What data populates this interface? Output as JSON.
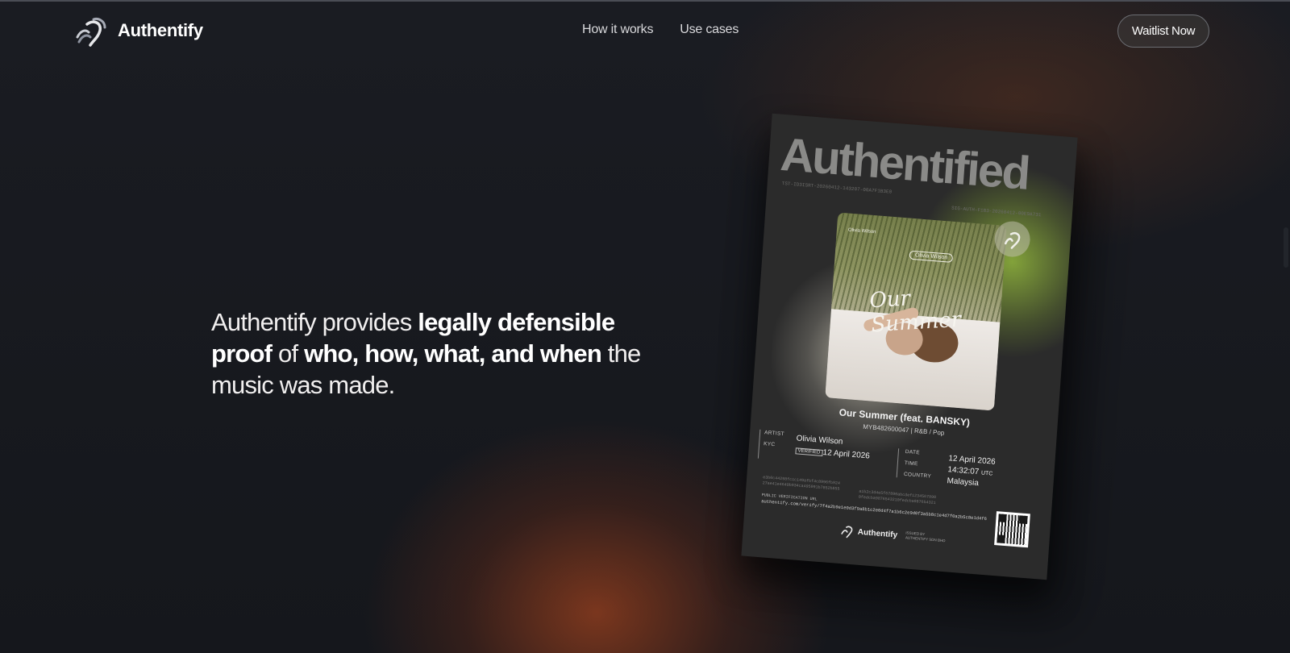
{
  "nav": {
    "brand": "Authentify",
    "links": [
      "How it works",
      "Use cases"
    ],
    "cta_label": "Waitlist Now"
  },
  "hero": {
    "p1": "Authentify provides ",
    "b1": "legally defensible proof",
    "p2": " of ",
    "b2": "who, how, what, and when",
    "p3": " the music was made."
  },
  "certificate": {
    "title": "Authentified",
    "code_left": "TST-ID3ISRT-20260412-143207-00A7F1B3E0",
    "code_right": "SIG-AUTH-F1B3-20260412-00E9A731",
    "cover_script": "Our Summer",
    "cover_tag": "Olivia Wilson",
    "cover_corner": "Olivia Wilson",
    "track_title": "Our Summer (feat. BANSKY)",
    "track_sub": "MYB482600047 | R&B / Pop",
    "artist_label": "ARTIST",
    "artist_value": "Olivia Wilson",
    "kyc_label": "KYC",
    "kyc_badge": "VERIFIED",
    "kyc_date": "12 April 2026",
    "date_label": "DATE",
    "date_value": "12 April 2026",
    "time_label": "TIME",
    "time_value": "14:32:07",
    "time_zone": "UTC",
    "country_label": "COUNTRY",
    "country_value": "Malaysia",
    "hash_left": "e3b0c44298fc1c149afbf4c8996fb924\n27ae41e4649b934ca495991b7852b855",
    "hash_right": "a1b2c3d4e5f67890abcdef1234567890\n0fedcba9876543210fedcba987654321",
    "url_label": "PUBLIC VERIFICATION URL",
    "url": "authentify.com/verify/7f4a2b9e1e0d3f9a8b1c2e0d4f7a1b6c2e9d0f3a5b8c1e4d7f0a2b5c8e1d4f6",
    "footer_brand": "Authentify",
    "footer_small": "ISSUED BY\nAUTHENTIFY SDN BHD"
  },
  "colors": {
    "background": "#15171d",
    "accent_glow": "#8c3c1e",
    "green_glow": "#8caf3c"
  },
  "icons": [
    "authentify-logo-icon",
    "authentify-badge-icon",
    "qr-code-icon"
  ]
}
